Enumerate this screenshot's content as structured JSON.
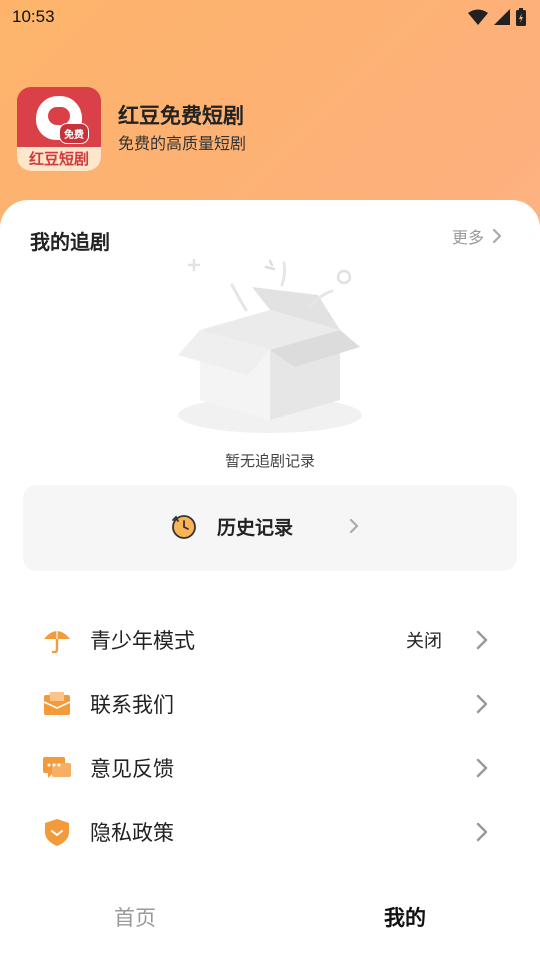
{
  "status": {
    "time": "10:53"
  },
  "profile": {
    "app_name": "红豆免费短剧",
    "slogan": "免费的高质量短剧",
    "logo_text": "红豆短剧",
    "logo_badge": "免费"
  },
  "following": {
    "title": "我的追剧",
    "more": "更多",
    "empty_text": "暂无追剧记录"
  },
  "history": {
    "label": "历史记录"
  },
  "menu": {
    "items": [
      {
        "label": "青少年模式",
        "value": "关闭",
        "icon": "umbrella-icon"
      },
      {
        "label": "联系我们",
        "icon": "mail-icon"
      },
      {
        "label": "意见反馈",
        "icon": "chat-icon"
      },
      {
        "label": "隐私政策",
        "icon": "shield-icon"
      }
    ]
  },
  "tabs": [
    {
      "label": "首页",
      "active": false
    },
    {
      "label": "我的",
      "active": true
    }
  ],
  "colors": {
    "accent_orange": "#f39a3b",
    "brand_red": "#d94048"
  }
}
